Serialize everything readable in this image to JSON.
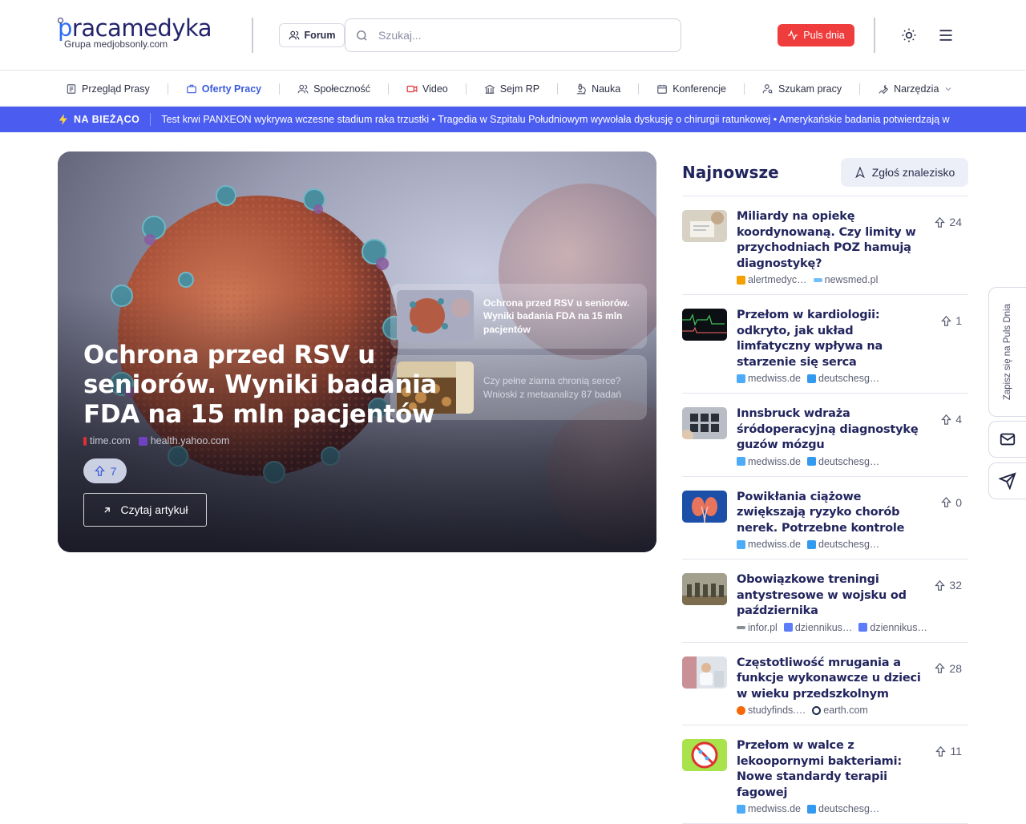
{
  "brand": {
    "logo_text_p": "p",
    "logo_text_rest": "racamedyka",
    "subtitle": "Grupa medjobsonly.com"
  },
  "header": {
    "forum_label": "Forum",
    "search_placeholder": "Szukaj...",
    "puls_label": "Puls dnia",
    "accent": "#ef3c3c"
  },
  "nav": {
    "items": [
      {
        "label": "Przegląd Prasy",
        "icon": "newspaper-icon"
      },
      {
        "label": "Oferty Pracy",
        "icon": "briefcase-icon",
        "active": true
      },
      {
        "label": "Społeczność",
        "icon": "users-icon"
      },
      {
        "label": "Video",
        "icon": "video-icon"
      },
      {
        "label": "Sejm RP",
        "icon": "landmark-icon"
      },
      {
        "label": "Nauka",
        "icon": "microscope-icon"
      },
      {
        "label": "Konferencje",
        "icon": "calendar-icon"
      },
      {
        "label": "Szukam pracy",
        "icon": "user-search-icon"
      },
      {
        "label": "Narzędzia",
        "icon": "wrench-icon"
      }
    ]
  },
  "ticker": {
    "label": "NA BIEŻĄCO",
    "text": "Test krwi PANXEON wykrywa wczesne stadium raka trzustki • Tragedia w Szpitalu Południowym wywołała dyskusję o chirurgii ratunkowej • Amerykańskie badania potwierdzają w",
    "color": "#4b5cf0"
  },
  "hero": {
    "title": "Ochrona przed RSV u seniorów. Wyniki badania FDA na 15 mln pacjentów",
    "sources": [
      "time.com",
      "health.yahoo.com"
    ],
    "votes": "7",
    "read_label": "Czytaj artykuł",
    "mini_cards": [
      {
        "title": "Ochrona przed RSV u seniorów. Wyniki badania FDA na 15 mln pacjentów"
      },
      {
        "title": "Czy pełne ziarna chronią serce? Wnioski z metaanalizy 87 badań"
      }
    ]
  },
  "sidebar": {
    "title": "Najnowsze",
    "report_label": "Zgłoś znalezisko",
    "items": [
      {
        "title": "Miliardy na opiekę koordynowaną. Czy limity w przychodniach POZ hamują diagnostykę?",
        "sources": [
          "alertmedyc…",
          "newsmed.pl"
        ],
        "votes": "24"
      },
      {
        "title": "Przełom w kardiologii: odkryto, jak układ limfatyczny wpływa na starzenie się serca",
        "sources": [
          "medwiss.de",
          "deutschesg…"
        ],
        "votes": "1"
      },
      {
        "title": "Innsbruck wdraża śródoperacyjną diagnostykę guzów mózgu",
        "sources": [
          "medwiss.de",
          "deutschesg…"
        ],
        "votes": "4"
      },
      {
        "title": "Powikłania ciążowe zwiększają ryzyko chorób nerek. Potrzebne kontrole",
        "sources": [
          "medwiss.de",
          "deutschesg…"
        ],
        "votes": "0"
      },
      {
        "title": "Obowiązkowe treningi antystresowe w wojsku od października",
        "sources": [
          "infor.pl",
          "dziennikus…",
          "dziennikus…"
        ],
        "votes": "32"
      },
      {
        "title": "Częstotliwość mrugania a funkcje wykonawcze u dzieci w wieku przedszkolnym",
        "sources": [
          "studyfinds.…",
          "earth.com"
        ],
        "votes": "28"
      },
      {
        "title": "Przełom w walce z lekoopornymi bakteriami: Nowe standardy terapii fagowej",
        "sources": [
          "medwiss.de",
          "deutschesg…"
        ],
        "votes": "11"
      }
    ]
  },
  "floating": {
    "subscribe_label": "Zapisz się na Puls Dnia"
  }
}
